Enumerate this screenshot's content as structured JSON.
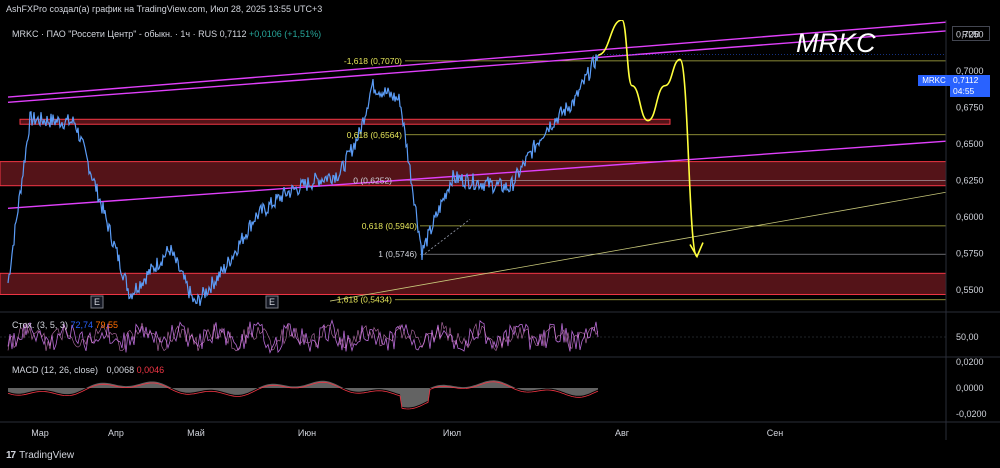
{
  "header": {
    "text": "AshFXPro создал(а) график на TradingView.com, Июл 28, 2025 13:55 UTC+3"
  },
  "symbol_line": {
    "name": "MRKC · ПАО \"Россети Центр\" - обыкн. · 1ч · RUS",
    "price": "0,7112",
    "change": "+0,0106 (+1,51%)"
  },
  "annotation": "MRKC",
  "currency": "RUB",
  "current_price": {
    "ticker": "MRKC",
    "value": "0,7112",
    "countdown": "04:55"
  },
  "price_axis": [
    "0,7250",
    "0,7000",
    "0,6750",
    "0,6500",
    "0,6250",
    "0,6000",
    "0,5750",
    "0,5500"
  ],
  "time_axis": [
    "Мар",
    "Апр",
    "Май",
    "Июн",
    "Июл",
    "Авг",
    "Сен"
  ],
  "event_markers": [
    "E",
    "E"
  ],
  "fib_levels": [
    {
      "label": "-1,618 (0,7070)",
      "value": 0.707,
      "color": "#e6e65a"
    },
    {
      "label": "0,618 (0,6564)",
      "value": 0.6564,
      "color": "#e6e65a"
    },
    {
      "label": "0 (0,6252)",
      "value": 0.6252,
      "color": "#d1d4dc"
    },
    {
      "label": "0,618 (0,5940)",
      "value": 0.594,
      "color": "#e6e65a"
    },
    {
      "label": "1 (0,5746)",
      "value": 0.5746,
      "color": "#d1d4dc"
    },
    {
      "label": "1,618 (0,5434)",
      "value": 0.5434,
      "color": "#e6e65a"
    }
  ],
  "stoch": {
    "label": "Стох. (3, 5, 3)",
    "k": "72,74",
    "d": "79,55",
    "axis": "50,00"
  },
  "macd": {
    "label": "MACD (12, 26, close)",
    "macd": "0,0068",
    "signal": "0,0046",
    "axis": [
      "0,0200",
      "0,0000",
      "-0,0200"
    ]
  },
  "footer": {
    "brand": "TradingView"
  },
  "chart_data": {
    "type": "line",
    "title": "",
    "xlabel": "",
    "ylabel": "",
    "ylim": [
      0.535,
      0.735
    ],
    "x": [
      "Мар",
      "Апр",
      "Май",
      "Июн",
      "Июл",
      "Авг"
    ],
    "series": [
      {
        "values": [
          0.555,
          0.667,
          0.665,
          0.547,
          0.578,
          0.54,
          0.565,
          0.6,
          0.616,
          0.625,
          0.63,
          0.658,
          0.69,
          0.68,
          0.576,
          0.627,
          0.62,
          0.66,
          0.68,
          0.711
        ]
      },
      {
        "values": [
          0.711,
          0.735,
          0.672,
          0.708,
          0.573
        ]
      }
    ],
    "zones": [
      [
        0.667,
        0.6636
      ],
      [
        0.638,
        0.6215
      ],
      [
        0.5615,
        0.547
      ]
    ]
  }
}
